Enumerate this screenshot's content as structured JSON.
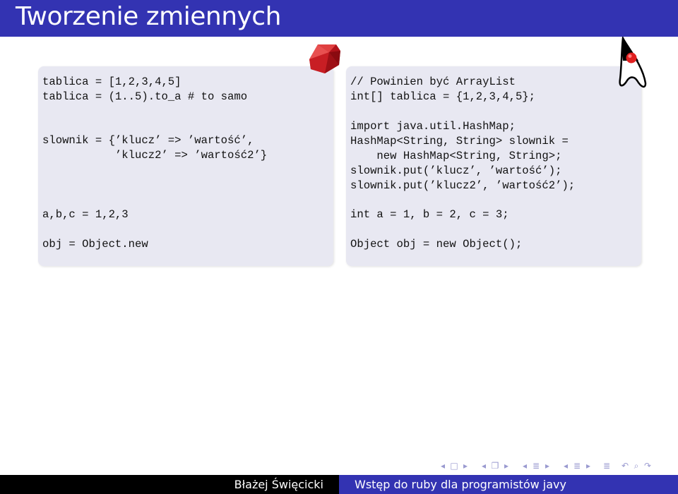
{
  "slide": {
    "title": "Tworzenie zmiennych"
  },
  "ruby_block": {
    "lines": [
      "tablica = [1,2,3,4,5]",
      "tablica = (1..5).to_a # to samo",
      "slownik = {’klucz’ => ’wartość’,",
      "           ’klucz2’ => ’wartość2’}",
      "a,b,c = 1,2,3",
      "obj = Object.new"
    ]
  },
  "java_block": {
    "lines": [
      "// Powinien być ArrayList",
      "int[] tablica = {1,2,3,4,5};",
      "import java.util.HashMap;",
      "HashMap<String, String> slownik =",
      "    new HashMap<String, String>;",
      "slownik.put(’klucz’, ’wartość’);",
      "slownik.put(’klucz2’, ’wartość2’);",
      "int a = 1, b = 2, c = 3;",
      "Object obj = new Object();"
    ]
  },
  "logos": {
    "left": "ruby-logo",
    "right": "java-duke-logo"
  },
  "navigation": {
    "icons": [
      "◂",
      "□",
      "▸",
      "◂",
      "❐",
      "▸",
      "◂",
      "≣",
      "▸",
      "◂",
      "≣",
      "▸",
      "≣",
      "↶",
      "⌕",
      "↷"
    ]
  },
  "footer": {
    "author": "Błażej Święcicki",
    "talk_title": "Wstęp do ruby dla programistów javy"
  },
  "colors": {
    "title_bg": "#3333b2",
    "block_bg": "#e8e8f2",
    "footer_author_bg": "#000000"
  }
}
